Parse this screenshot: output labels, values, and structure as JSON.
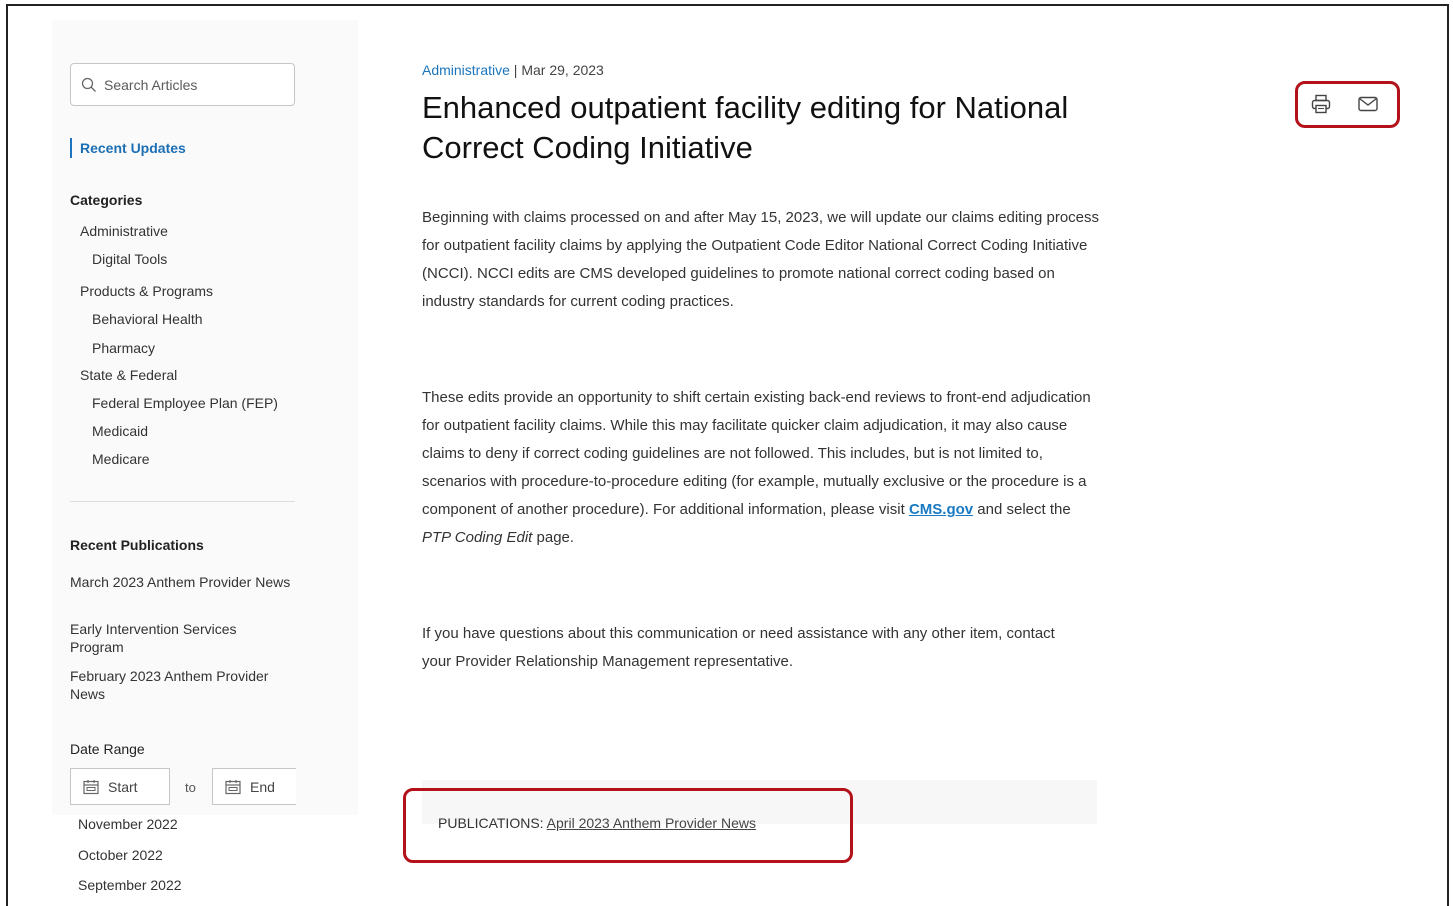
{
  "search": {
    "placeholder": "Search Articles"
  },
  "sidebar": {
    "recent_updates": "Recent Updates",
    "categories_heading": "Categories",
    "categories": [
      "Administrative",
      "Digital Tools",
      "Products & Programs",
      "Behavioral Health",
      "Pharmacy",
      "State & Federal",
      "Federal Employee Plan (FEP)",
      "Medicaid",
      "Medicare"
    ],
    "recent_publications_heading": "Recent Publications",
    "recent_publications": [
      "March 2023 Anthem Provider News",
      "Early Intervention Services Program",
      "February 2023 Anthem Provider News"
    ],
    "date_range": {
      "label": "Date Range",
      "start": "Start",
      "to": "to",
      "end": "End"
    },
    "months": [
      "November 2022",
      "October 2022",
      "September 2022"
    ]
  },
  "article": {
    "category": "Administrative",
    "separator": " | ",
    "date": "Mar 29, 2023",
    "title": "Enhanced outpatient facility editing for National Correct Coding Initiative",
    "para1": "Beginning with claims processed on and after May 15, 2023, we will update our claims editing process for outpatient facility claims by applying the Outpatient Code Editor National Correct Coding Initiative (NCCI). NCCI edits are CMS developed guidelines to promote national correct coding based on industry standards for current coding practices.",
    "para2_before_link": "These edits provide an opportunity to shift certain existing back-end reviews to front-end adjudication for outpatient facility claims. While this may facilitate quicker claim adjudication, it may also cause claims to deny if correct coding guidelines are not followed. This includes, but is not limited to, scenarios with procedure-to-procedure editing (for example, mutually exclusive or the procedure is a component of another procedure). For additional information, please visit ",
    "para2_link": "CMS.gov",
    "para2_middle": " and select the ",
    "para2_italic": "PTP Coding Edit",
    "para2_end": " page.",
    "para3": "If you have questions about this communication or need assistance with any other item, contact your Provider Relationship Management representative.",
    "publications_label": "PUBLICATIONS: ",
    "publications_link": "April 2023 Anthem Provider News"
  },
  "toolbar": {
    "print_icon": "printer-icon",
    "email_icon": "envelope-icon"
  },
  "colors": {
    "link": "#1c75bc",
    "highlight": "#b3121b"
  }
}
